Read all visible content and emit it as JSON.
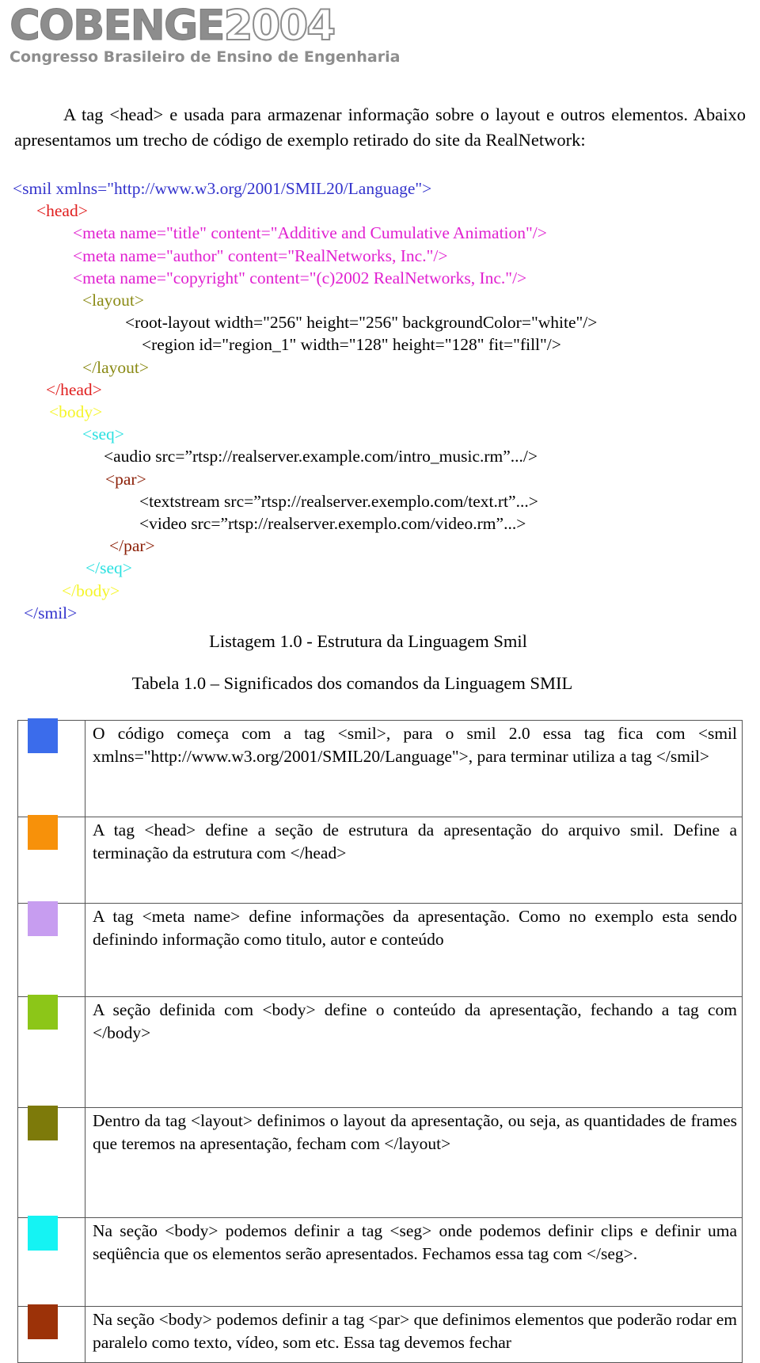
{
  "logo": {
    "main_solid": "COBENGE",
    "main_hollow": "2004",
    "subtitle": "Congresso Brasileiro de Ensino de Engenharia",
    "color": "#8d8d8d"
  },
  "intro": {
    "text": "A tag <head> e usada para armazenar informação sobre o layout e outros elementos. Abaixo apresentamos um trecho de código de exemplo retirado do site da RealNetwork:"
  },
  "code_listing": {
    "colors": {
      "smil": "#3333cc",
      "head": "#e02020",
      "meta": "#e020d0",
      "layout": "#8a8a14",
      "plain": "#000000",
      "body": "#f5f52a",
      "seq": "#28e0e0",
      "par": "#8c2008"
    },
    "lines": [
      {
        "indent": 0,
        "color": "smil",
        "text": "<smil xmlns=\"http://www.w3.org/2001/SMIL20/Language\">"
      },
      {
        "indent": 30,
        "color": "head",
        "text": "<head>"
      },
      {
        "indent": 76,
        "color": "meta",
        "text": "<meta name=\"title\" content=\"Additive and Cumulative Animation\"/>"
      },
      {
        "indent": 76,
        "color": "meta",
        "text": "<meta name=\"author\" content=\"RealNetworks, Inc.\"/>"
      },
      {
        "indent": 76,
        "color": "meta",
        "text": "<meta name=\"copyright\" content=\"(c)2002 RealNetworks, Inc.\"/>"
      },
      {
        "indent": 88,
        "color": "layout",
        "text": "<layout>"
      },
      {
        "indent": 142,
        "color": "plain",
        "text": "<root-layout width=\"256\" height=\"256\" backgroundColor=\"white\"/>"
      },
      {
        "indent": 163,
        "color": "plain",
        "text": "<region id=\"region_1\" width=\"128\" height=\"128\" fit=\"fill\"/>"
      },
      {
        "indent": 88,
        "color": "layout",
        "text": "</layout>"
      },
      {
        "indent": 42,
        "color": "head",
        "text": "</head>"
      },
      {
        "indent": 46,
        "color": "body",
        "text": "<body>"
      },
      {
        "indent": 88,
        "color": "seq",
        "text": "<seq>"
      },
      {
        "indent": 115,
        "color": "plain",
        "text": "<audio src=”rtsp://realserver.example.com/intro_music.rm”.../>"
      },
      {
        "indent": 117,
        "color": "par",
        "text": "<par>"
      },
      {
        "indent": 160,
        "color": "plain",
        "text": "<textstream src=”rtsp://realserver.exemplo.com/text.rt”...>"
      },
      {
        "indent": 160,
        "color": "plain",
        "text": "<video src=”rtsp://realserver.exemplo.com/video.rm”...>"
      },
      {
        "indent": 122,
        "color": "par",
        "text": "</par>"
      },
      {
        "indent": 92,
        "color": "seq",
        "text": "</seq>"
      },
      {
        "indent": 62,
        "color": "body",
        "text": "</body>"
      },
      {
        "indent": 14,
        "color": "smil",
        "text": "</smil>"
      }
    ]
  },
  "captions": {
    "listagem": "Listagem 1.0 -  Estrutura da Linguagem Smil",
    "tabela": "Tabela 1.0 – Significados dos comandos da Linguagem SMIL"
  },
  "tabela": {
    "rows": [
      {
        "swatch_color": "#3b6ceb",
        "swatch_name": "swatch-smil",
        "text": "O código começa com a tag <smil>, para o smil 2.0 essa tag fica com <smil  xmlns=\"http://www.w3.org/2001/SMIL20/Language\">, para terminar utiliza a tag </smil>"
      },
      {
        "swatch_color": "#f7910a",
        "swatch_name": "swatch-head",
        "text": "A tag <head>  define a seção de estrutura da apresentação do arquivo smil. Define a terminação da estrutura com </head>"
      },
      {
        "swatch_color": "#c79df0",
        "swatch_name": "swatch-meta",
        "text": "A tag <meta name> define informações da apresentação. Como no exemplo esta sendo definindo  informação  como titulo, autor e conteúdo"
      },
      {
        "swatch_color": "#8cc618",
        "swatch_name": "swatch-body",
        "text": "A seção definida com <body> define o conteúdo da apresentação, fechando a tag com </body>"
      },
      {
        "swatch_color": "#7d7a0a",
        "swatch_name": "swatch-layout",
        "text": "Dentro da tag <layout> definimos o layout da apresentação, ou seja, as quantidades de frames que teremos na apresentação, fecham com </layout>"
      },
      {
        "swatch_color": "#15f3f3",
        "swatch_name": "swatch-seg",
        "text": "Na seção <body> podemos definir a tag <seg> onde podemos definir clips e definir uma seqüência que os elementos serão apresentados. Fechamos essa tag com </seg>."
      },
      {
        "swatch_color": "#9c3208",
        "swatch_name": "swatch-par",
        "text": "Na seção <body> podemos definir a tag <par> que definimos elementos que poderão rodar em paralelo como texto, vídeo, som etc. Essa tag devemos fechar"
      }
    ]
  }
}
